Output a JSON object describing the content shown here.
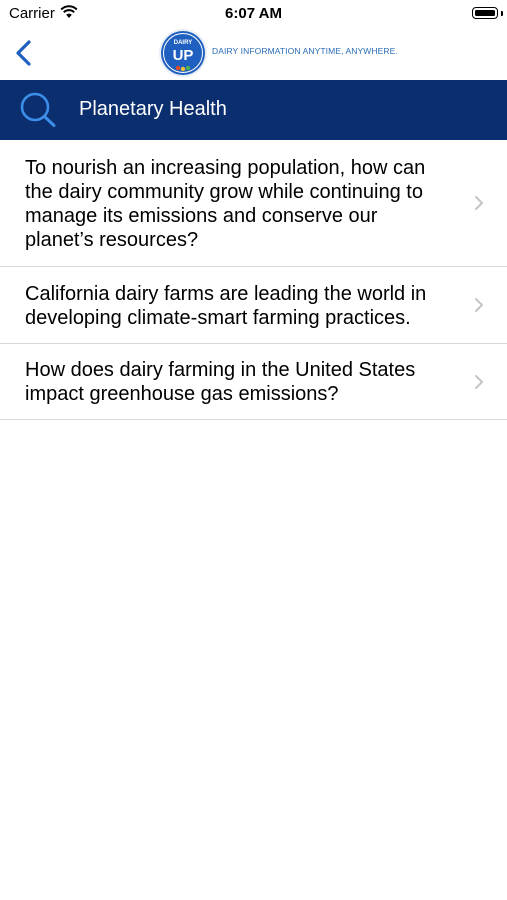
{
  "status_bar": {
    "carrier": "Carrier",
    "time": "6:07 AM",
    "battery_level": 1.0
  },
  "nav": {
    "back_icon": "chevron-left-icon",
    "logo_top": "DAIRY",
    "logo_main": "UP",
    "tagline": "DAIRY INFORMATION ANYTIME, ANYWHERE."
  },
  "header": {
    "title": "Planetary Health",
    "icon": "search-icon",
    "background": "#0b2e6f"
  },
  "articles": [
    {
      "title": "To nourish an increasing population, how can the dairy community grow while continuing to manage its emissions and conserve our planet’s resources?"
    },
    {
      "title": "California dairy farms are leading the world in developing climate-smart farming practices."
    },
    {
      "title": "How does dairy farming in the United States impact greenhouse gas emissions?"
    }
  ],
  "colors": {
    "accent": "#2a6db5",
    "header_bg": "#0b2e6f",
    "chevron": "#c4c4c6"
  }
}
